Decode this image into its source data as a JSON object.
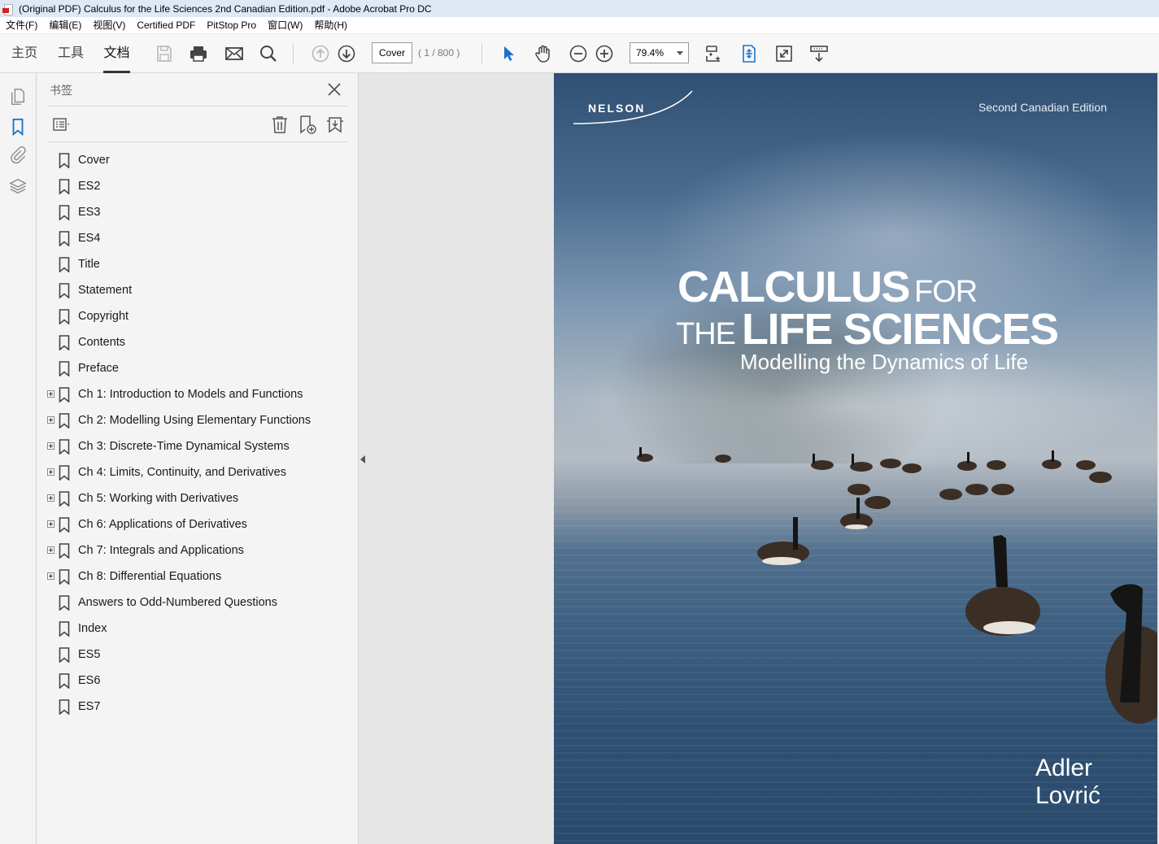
{
  "window": {
    "title": "(Original PDF) Calculus for the Life Sciences 2nd Canadian Edition.pdf - Adobe Acrobat Pro DC"
  },
  "menu": [
    "文件(F)",
    "编辑(E)",
    "视图(V)",
    "Certified PDF",
    "PitStop Pro",
    "窗口(W)",
    "帮助(H)"
  ],
  "tabs": [
    {
      "label": "主页",
      "active": false
    },
    {
      "label": "工具",
      "active": false
    },
    {
      "label": "文档",
      "active": true
    }
  ],
  "toolbar": {
    "page_label": "Cover",
    "page_count": "( 1 / 800 )",
    "zoom": "79.4%"
  },
  "panel": {
    "title": "书签",
    "bookmarks": [
      {
        "label": "Cover",
        "expandable": false
      },
      {
        "label": "ES2",
        "expandable": false
      },
      {
        "label": "ES3",
        "expandable": false
      },
      {
        "label": "ES4",
        "expandable": false
      },
      {
        "label": "Title",
        "expandable": false
      },
      {
        "label": "Statement",
        "expandable": false
      },
      {
        "label": "Copyright",
        "expandable": false
      },
      {
        "label": "Contents",
        "expandable": false
      },
      {
        "label": "Preface",
        "expandable": false
      },
      {
        "label": "Ch 1: Introduction to Models and Functions",
        "expandable": true
      },
      {
        "label": "Ch 2: Modelling Using Elementary Functions",
        "expandable": true
      },
      {
        "label": "Ch 3: Discrete-Time Dynamical Systems",
        "expandable": true
      },
      {
        "label": "Ch 4: Limits, Continuity, and Derivatives",
        "expandable": true
      },
      {
        "label": "Ch 5: Working with Derivatives",
        "expandable": true
      },
      {
        "label": "Ch 6: Applications of Derivatives",
        "expandable": true
      },
      {
        "label": "Ch 7: Integrals and Applications",
        "expandable": true
      },
      {
        "label": "Ch 8: Differential Equations",
        "expandable": true
      },
      {
        "label": "Answers to Odd-Numbered Questions",
        "expandable": false
      },
      {
        "label": "Index",
        "expandable": false
      },
      {
        "label": "ES5",
        "expandable": false
      },
      {
        "label": "ES6",
        "expandable": false
      },
      {
        "label": "ES7",
        "expandable": false
      }
    ]
  },
  "cover": {
    "publisher": "NELSON",
    "edition": "Second Canadian Edition",
    "title_calculus": "CALCULUS",
    "title_for": "FOR",
    "title_the": "THE",
    "title_life_sciences": "LIFE SCIENCES",
    "subtitle": "Modelling the Dynamics of Life",
    "author_1": "Adler",
    "author_2": "Lovrić"
  },
  "colors": {
    "accent_blue": "#1a73c8",
    "titlebar": "#dfe9f5"
  }
}
